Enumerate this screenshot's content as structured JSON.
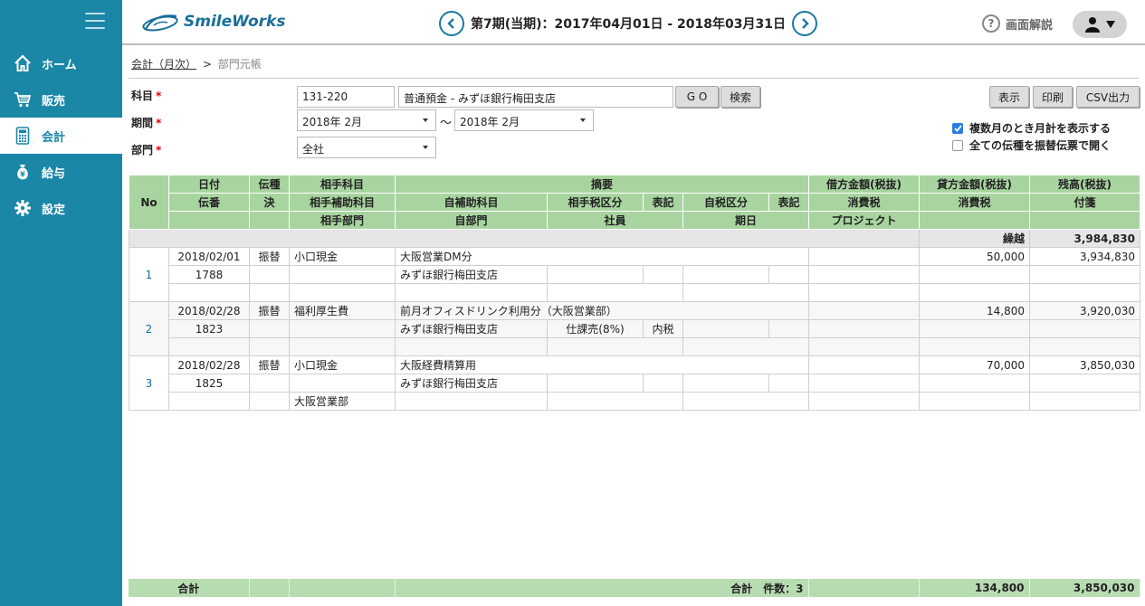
{
  "app": {
    "logo_text": "SmileWorks"
  },
  "header": {
    "period": "第7期(当期)：2017年04月01日 - 2018年03月31日",
    "help_label": "画面解説"
  },
  "sidebar": {
    "items": [
      {
        "label": "ホーム",
        "icon": "home-icon"
      },
      {
        "label": "販売",
        "icon": "cart-icon"
      },
      {
        "label": "会計",
        "icon": "calculator-icon",
        "active": true
      },
      {
        "label": "給与",
        "icon": "money-bag-icon"
      },
      {
        "label": "設定",
        "icon": "gear-icon"
      }
    ]
  },
  "breadcrumb": {
    "parent": "会計（月次）",
    "separator": ">",
    "current": "部門元帳"
  },
  "form": {
    "account_label": "科目",
    "account_code": "131-220",
    "account_name": "普通預金 - みずほ銀行梅田支店",
    "go_label": "G O",
    "search_label": "検索",
    "period_label": "期間",
    "period_from": "2018年 2月",
    "period_sep": "〜",
    "period_to": "2018年 2月",
    "dept_label": "部門",
    "dept_value": "全社",
    "required_mark": "*"
  },
  "actions": {
    "display": "表示",
    "print": "印刷",
    "csv": "CSV出力"
  },
  "options": {
    "monthly_total": {
      "label": "複数月のとき月計を表示する",
      "checked": true
    },
    "open_transfer": {
      "label": "全ての伝種を振替伝票で開く",
      "checked": false
    }
  },
  "table": {
    "header": {
      "no": "No",
      "row1": [
        "日付",
        "伝種",
        "相手科目",
        "摘要",
        "借方金額(税抜)",
        "貸方金額(税抜)",
        "残高(税抜)"
      ],
      "row2": [
        "伝番",
        "決",
        "相手補助科目",
        "自補助科目",
        "相手税区分",
        "表記",
        "自税区分",
        "表記",
        "消費税",
        "消費税",
        "付箋"
      ],
      "row3": [
        "相手部門",
        "自部門",
        "社員",
        "期日",
        "プロジェクト"
      ]
    },
    "carry": {
      "label": "繰越",
      "balance": "3,984,830"
    },
    "entries": [
      {
        "no": "1",
        "date": "2018/02/01",
        "kind": "振替",
        "counter_account": "小口現金",
        "summary": "大阪営業DM分",
        "debit": "",
        "credit": "50,000",
        "balance": "3,934,830",
        "voucher": "1788",
        "own_sub": "みずほ銀行梅田支店",
        "counter_tax": "",
        "counter_tax_mark": "",
        "counter_dept": ""
      },
      {
        "no": "2",
        "date": "2018/02/28",
        "kind": "振替",
        "counter_account": "福利厚生費",
        "summary": "前月オフィスドリンク利用分（大阪営業部）",
        "debit": "",
        "credit": "14,800",
        "balance": "3,920,030",
        "voucher": "1823",
        "own_sub": "みずほ銀行梅田支店",
        "counter_tax": "仕課売(8%)",
        "counter_tax_mark": "内税",
        "counter_dept": ""
      },
      {
        "no": "3",
        "date": "2018/02/28",
        "kind": "振替",
        "counter_account": "小口現金",
        "summary": "大阪経費精算用",
        "debit": "",
        "credit": "70,000",
        "balance": "3,850,030",
        "voucher": "1825",
        "own_sub": "みずほ銀行梅田支店",
        "counter_tax": "",
        "counter_tax_mark": "",
        "counter_dept": "大阪営業部"
      }
    ],
    "footer": {
      "label": "合計",
      "count_text": "合計　件数：3",
      "credit_total": "134,800",
      "balance_total": "3,850,030"
    }
  },
  "colors": {
    "sidebar": "#1a87a7",
    "table_header": "#a8d4a0",
    "footer": "#b8dcb2",
    "accent": "#1a6e99"
  }
}
